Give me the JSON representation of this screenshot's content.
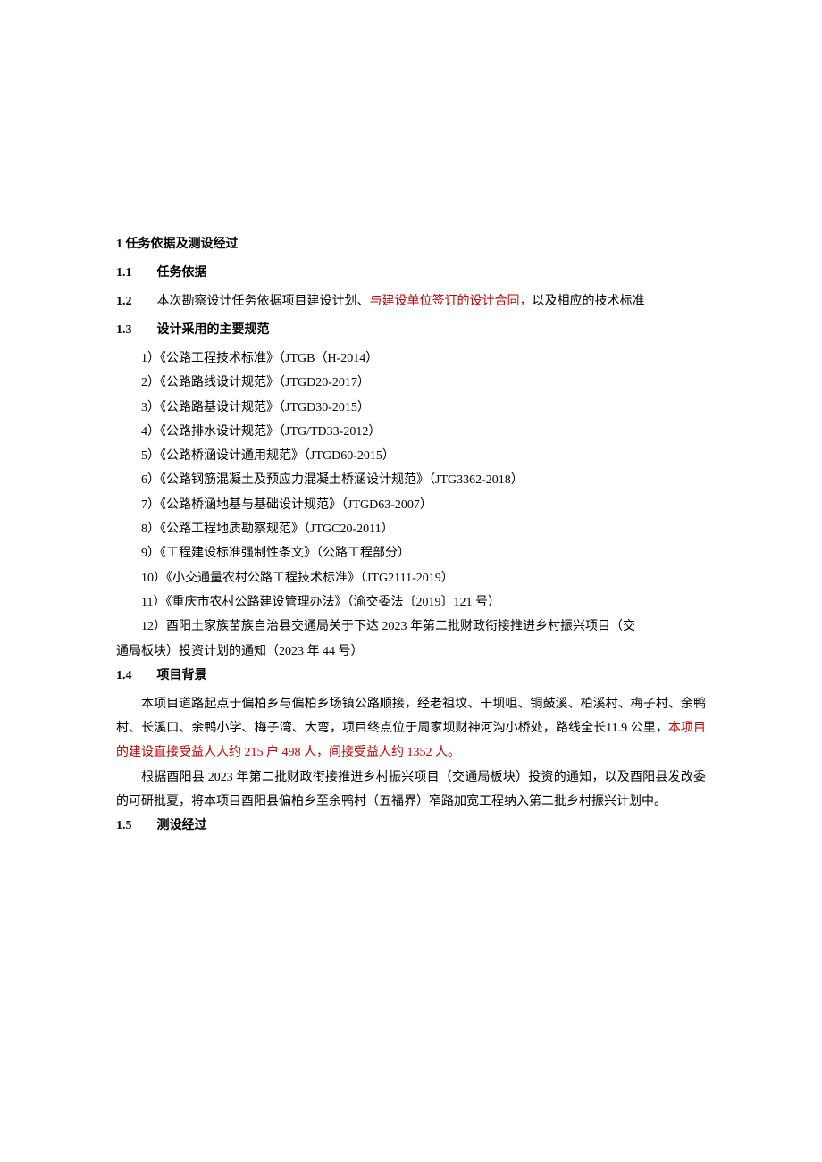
{
  "section1": {
    "title": "1 任务依据及测设经过",
    "sub1": {
      "num": "1.1",
      "label": "任务依据"
    },
    "sub2": {
      "num": "1.2",
      "text_a": "本次勘察设计任务依据项目建设计划、",
      "text_red": "与建设单位签订的设计合同，",
      "text_b": "以及相应的技术标准"
    },
    "sub3": {
      "num": "1.3",
      "label": "设计采用的主要规范",
      "items": [
        "1）《公路工程技术标准》（JTGB（H-2014）",
        "2）《公路路线设计规范》（JTGD20-2017）",
        "3）《公路路基设计规范》（JTGD30-2015）",
        "4）《公路排水设计规范》（JTG/TD33-2012）",
        "5）《公路桥涵设计通用规范》（JTGD60-2015）",
        "6）《公路钢筋混凝土及预应力混凝土桥涵设计规范》（JTG3362-2018）",
        "7）《公路桥涵地基与基础设计规范》（JTGD63-2007）",
        "8）《公路工程地质勘察规范》（JTGC20-2011）",
        "9）《工程建设标准强制性条文》（公路工程部分）",
        "10）《小交通量农村公路工程技术标准》（JTG2111-2019）",
        "11）《重庆市农村公路建设管理办法》（渝交委法〔2019〕121 号）"
      ],
      "item12_a": "12）酉阳土家族苗族自治县交通局关于下达 2023 年第二批财政衔接推进乡村振兴项目（交",
      "item12_b": "通局板块）投资计划的通知（2023 年 44 号）"
    },
    "sub4": {
      "num": "1.4",
      "label": "项目背景",
      "p1_a": "本项目道路起点于偏柏乡与偏柏乡场镇公路顺接，经老祖坟、干坝咀、铜鼓溪、柏溪村、梅子村、余鸭村、长溪口、余鸭小学、梅子湾、大弯，项目终点位于周家坝财神河沟小桥处，路线全长11.9 公里，",
      "p1_red": "本项目的建设直接受益人人约 215 户 498 人，间接受益人约 1352 人。",
      "p2": "根据酉阳县 2023 年第二批财政衔接推进乡村振兴项目（交通局板块）投资的通知，以及酉阳县发改委的可研批夏，将本项目酉阳县偏柏乡至余鸭村（五福界）窄路加宽工程纳入第二批乡村振兴计划中。"
    },
    "sub5": {
      "num": "1.5",
      "label": "测设经过"
    }
  }
}
